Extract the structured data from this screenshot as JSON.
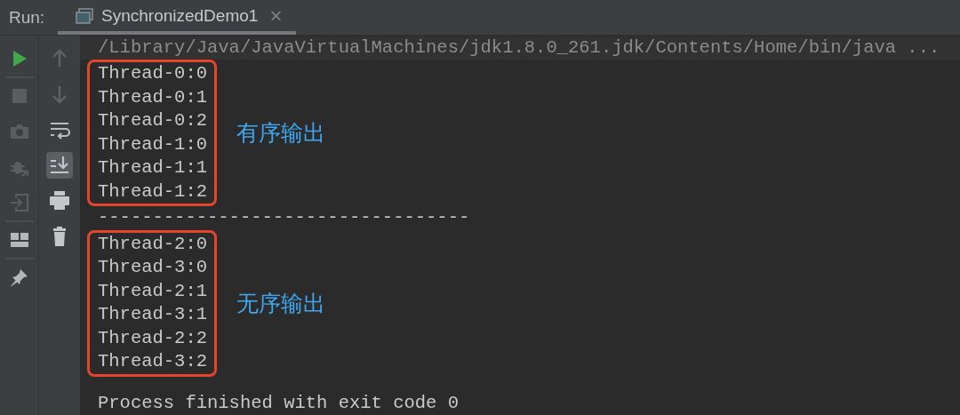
{
  "run_bar": {
    "label": "Run:",
    "tab": {
      "title": "SynchronizedDemo1",
      "selected": true,
      "close": "×"
    }
  },
  "left_toolbar": [
    {
      "kind": "run",
      "disabled": false
    },
    {
      "kind": "separator"
    },
    {
      "kind": "stop",
      "disabled": true
    },
    {
      "kind": "camera",
      "disabled": true
    },
    {
      "kind": "debug",
      "disabled": true
    },
    {
      "kind": "exit",
      "disabled": true
    },
    {
      "kind": "separator"
    },
    {
      "kind": "layout",
      "disabled": false
    },
    {
      "kind": "separator"
    },
    {
      "kind": "pin",
      "disabled": false
    }
  ],
  "console_toolbar": [
    {
      "kind": "up",
      "selected": false
    },
    {
      "kind": "down",
      "selected": false
    },
    {
      "kind": "wrap",
      "selected": false
    },
    {
      "kind": "scroll-end",
      "selected": true
    },
    {
      "kind": "print",
      "selected": false
    },
    {
      "kind": "trash",
      "selected": false
    }
  ],
  "console": {
    "command": "/Library/Java/JavaVirtualMachines/jdk1.8.0_261.jdk/Contents/Home/bin/java ...",
    "groups": [
      {
        "lines": [
          "Thread-0:0",
          "Thread-0:1",
          "Thread-0:2",
          "Thread-1:0",
          "Thread-1:1",
          "Thread-1:2"
        ],
        "note": "有序输出"
      },
      {
        "lines": [
          "Thread-2:0",
          "Thread-3:0",
          "Thread-2:1",
          "Thread-3:1",
          "Thread-2:2",
          "Thread-3:2"
        ],
        "note": "无序输出"
      }
    ],
    "separator": "----------------------------------",
    "exit_message": "Process finished with exit code 0"
  }
}
